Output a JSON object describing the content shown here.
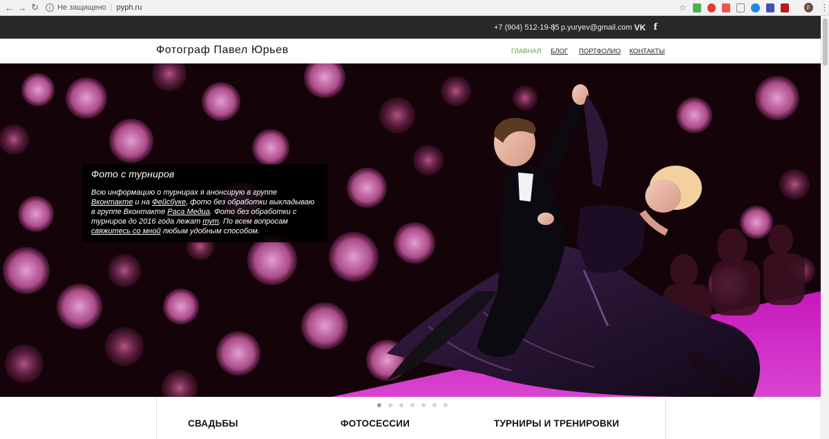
{
  "browser": {
    "security_label": "Не защищено",
    "url": "pyph.ru",
    "profile_letter": "F"
  },
  "topbar": {
    "phone": "+7 (904) 512-19-85",
    "divider": "|",
    "email": "p.yuryev@gmail.com",
    "vk_label": "VK",
    "fb_label": "f"
  },
  "header": {
    "site_title": "Фотограф Павел Юрьев",
    "menu": [
      "ГЛАВНАЯ",
      "БЛОГ",
      "ПОРТФОЛИО",
      "КОНТАКТЫ"
    ],
    "active_index": 0,
    "active_color": "#5aa63f"
  },
  "slide": {
    "title": "Фото с турниров",
    "t1": "Всю информацию о турнирах я анонсирую в группе ",
    "l1": "Вконтакте",
    "t2": " и на ",
    "l2": "Фейсбуке",
    "t3": ", фото без обработки выкладываю в группе Вконтакте ",
    "l3": "Раса Медиа",
    "t4": ". Фото без обработки с турниров до 2016 года лежат ",
    "l4": "тут",
    "t5": ". По всем вопросам ",
    "l5": "свяжитесь со мной",
    "t6": " любым удобным способом.",
    "count": 7,
    "active": 0
  },
  "sections": [
    "СВАДЬБЫ",
    "ФОТОСЕССИИ",
    "ТУРНИРЫ И ТРЕНИРОВКИ"
  ]
}
